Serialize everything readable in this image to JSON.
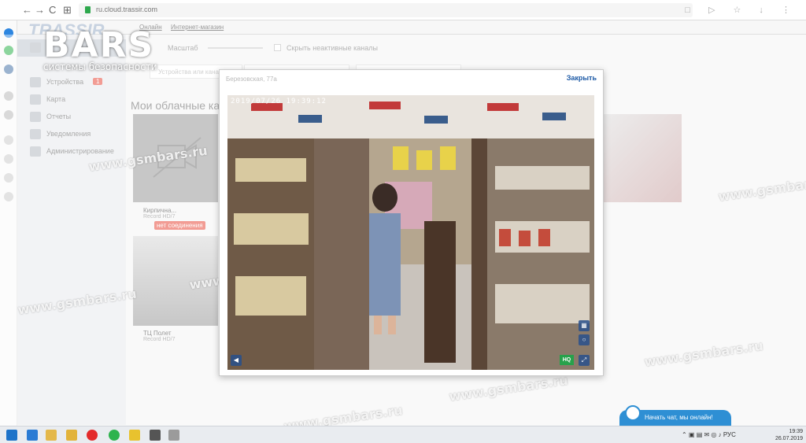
{
  "browser": {
    "url": "ru.cloud.trassir.com",
    "nav": [
      "←",
      "→",
      "C",
      "⊞"
    ]
  },
  "header": {
    "links": [
      "Онлайн",
      "Интернет-магазин"
    ]
  },
  "watermark": {
    "brand": "BARS",
    "subtitle": "системы безопасности",
    "site": "www.gsmbars.ru"
  },
  "sidebar": {
    "items": [
      {
        "label": "",
        "active": true
      },
      {
        "label": "Устройства",
        "badge": "1"
      },
      {
        "label": "Карта"
      },
      {
        "label": "Отчеты"
      },
      {
        "label": "Уведомления"
      },
      {
        "label": "Администрирование"
      }
    ]
  },
  "toolbar": {
    "scale_label": "Масштаб",
    "hide_inactive": "Скрыть неактивные каналы",
    "search_placeholder": "Устройства или канал"
  },
  "main": {
    "section_title": "Мои облачные ка",
    "cards": [
      {
        "name": "Кирпична...",
        "sub": "Record HD/7",
        "status": "нет соединения"
      },
      {
        "name": "ТЦ Полет",
        "sub": "Record HD/7"
      }
    ]
  },
  "modal": {
    "title": "Березовская, 77а",
    "close_label": "Закрыть",
    "timestamp": "2019/07/26 19:39:12",
    "hq_label": "HQ"
  },
  "chat": {
    "label": "Начать чат, мы онлайн!"
  },
  "taskbar": {
    "lang": "РУС",
    "time": "19:39",
    "date": "26.07.2019"
  }
}
